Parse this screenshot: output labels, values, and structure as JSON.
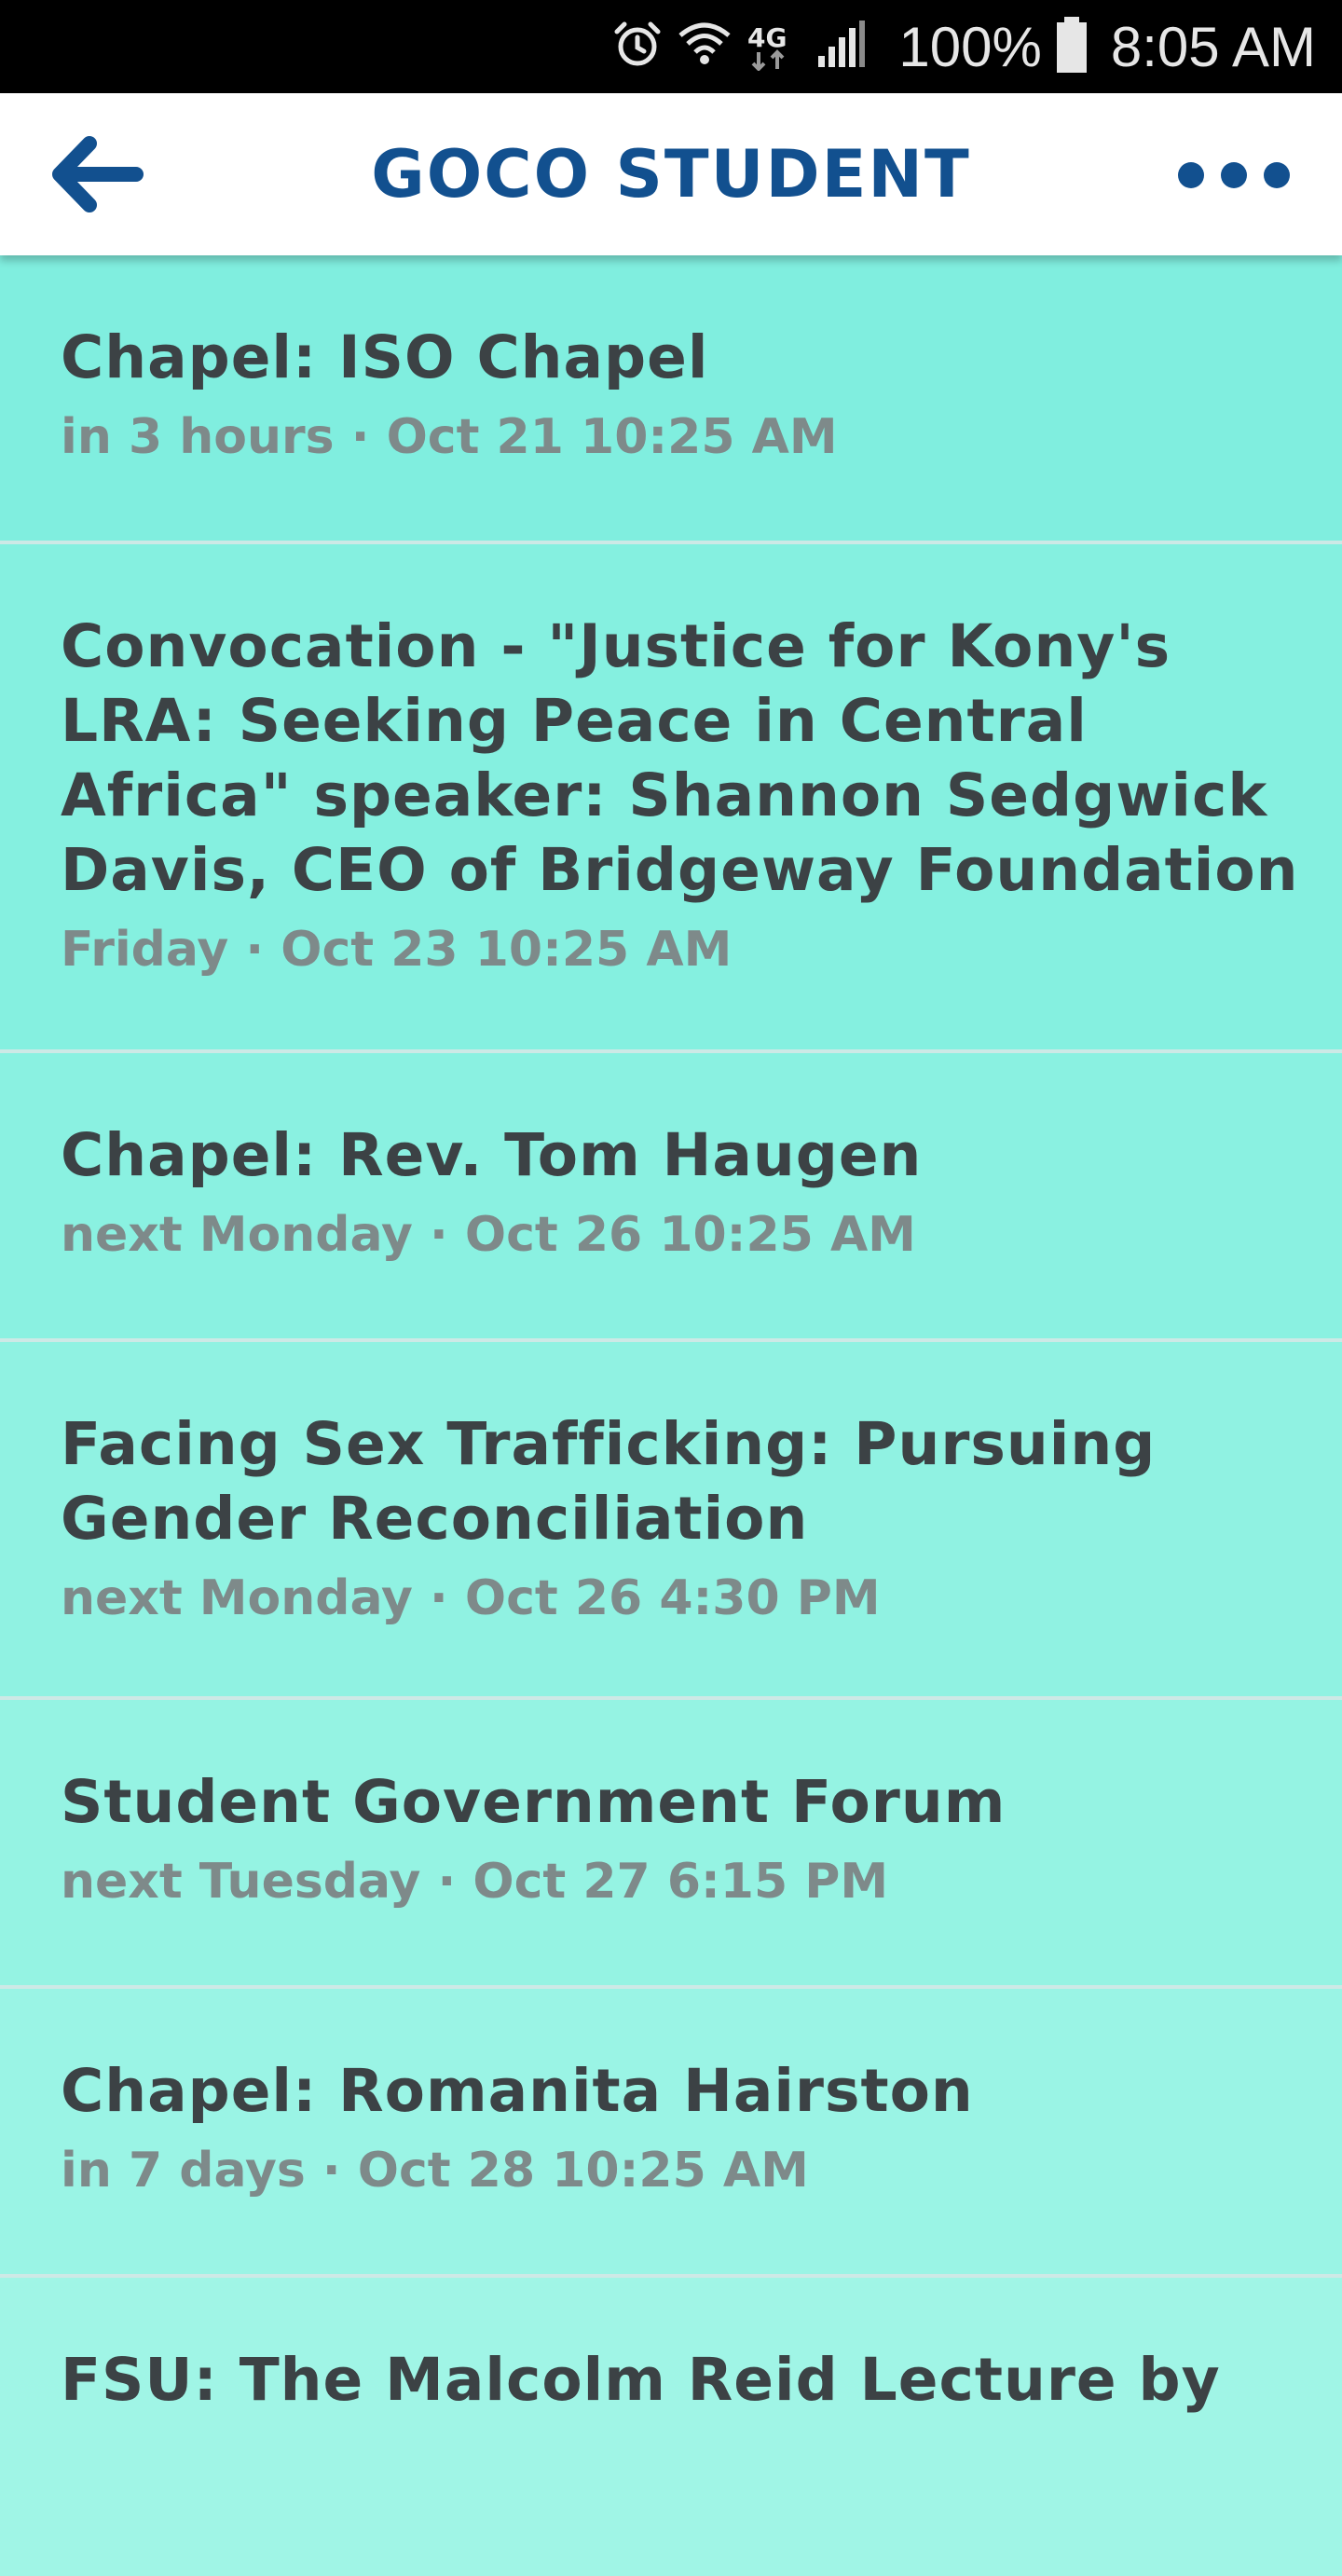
{
  "status_bar": {
    "battery": "100%",
    "time": "8:05 AM",
    "network": "4G",
    "icons": [
      "alarm-icon",
      "wifi-icon",
      "network-4g-icon",
      "signal-icon",
      "battery-icon"
    ]
  },
  "app_bar": {
    "title": "GOCO STUDENT",
    "back_icon": "arrow-left-icon",
    "menu_icon": "more-horizontal-icon",
    "accent": "#12508f"
  },
  "events": [
    {
      "title": "Chapel: ISO Chapel",
      "relative": "in 3 hours",
      "date": "Oct 21 10:25 AM"
    },
    {
      "title": "Convocation - \"Justice for Kony's LRA: Seeking Peace in Central Africa\" speaker: Shannon Sedgwick Davis, CEO of Bridgeway Foundation",
      "relative": "Friday",
      "date": "Oct 23 10:25 AM"
    },
    {
      "title": "Chapel: Rev. Tom Haugen",
      "relative": "next Monday",
      "date": "Oct 26 10:25 AM"
    },
    {
      "title": "Facing Sex Trafficking: Pursuing Gender Reconciliation",
      "relative": "next Monday",
      "date": "Oct 26 4:30 PM"
    },
    {
      "title": "Student Government Forum",
      "relative": "next Tuesday",
      "date": "Oct 27 6:15 PM"
    },
    {
      "title": "Chapel: Romanita Hairston",
      "relative": "in 7 days",
      "date": "Oct 28 10:25 AM"
    },
    {
      "title": "FSU: The Malcolm Reid Lecture by",
      "relative": "",
      "date": ""
    }
  ],
  "colors": {
    "item_backgrounds": [
      "#80eedf",
      "#85f0e0",
      "#8af1e1",
      "#90f2e2",
      "#95f3e3",
      "#9af4e5",
      "#a0f5e6"
    ],
    "title_text": "#3c4245",
    "subtitle_text": "#7e8a8a"
  }
}
